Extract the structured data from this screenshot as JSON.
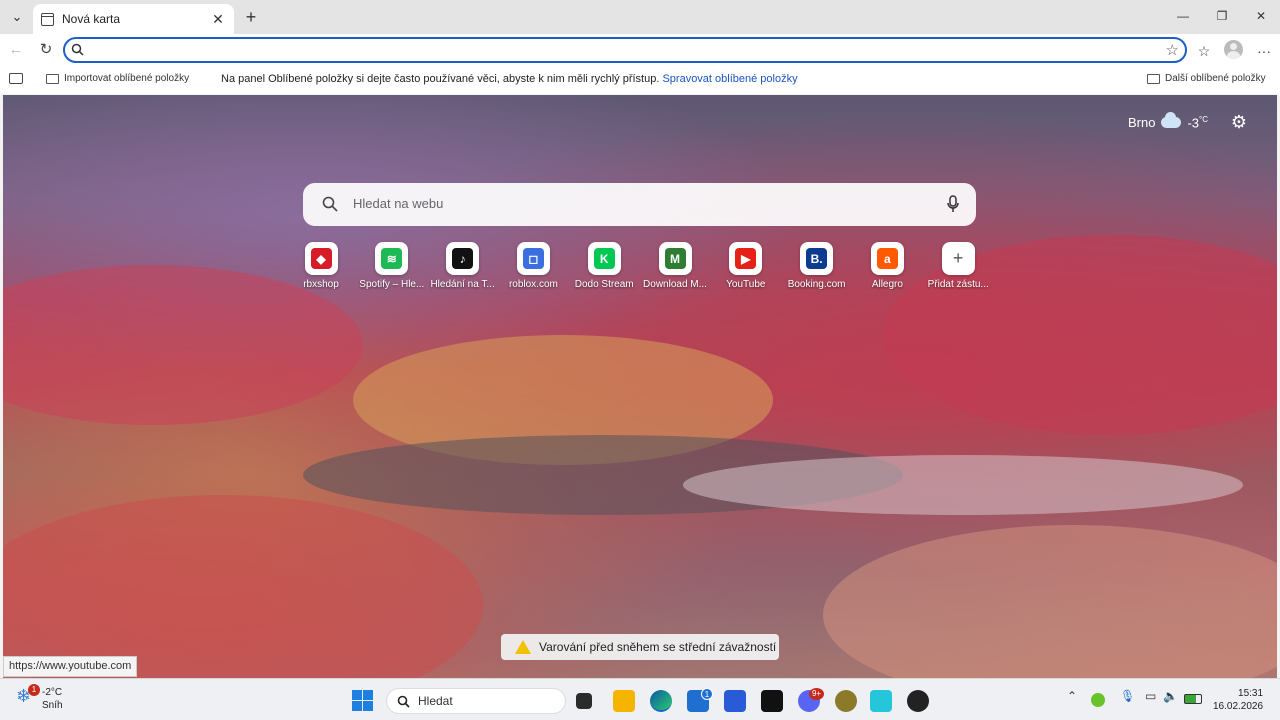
{
  "browser": {
    "tab_title": "Nová karta",
    "address_value": "",
    "address_placeholder": ""
  },
  "favorites_bar": {
    "import_label": "Importovat oblíbené položky",
    "message": "Na panel Oblíbené položky si dejte často používané věci, abyste k nim měli rychlý přístup.",
    "manage_link": "Spravovat oblíbené položky",
    "other_favorites": "Další oblíbené položky"
  },
  "newtab": {
    "weather_city": "Brno",
    "weather_temp": "-3",
    "weather_unit": "°C",
    "search_placeholder": "Hledat na webu",
    "tiles": [
      {
        "label": "rbxshop",
        "color": "#d81b29",
        "glyph": "◆"
      },
      {
        "label": "Spotify – Hle...",
        "color": "#1db954",
        "glyph": "≋"
      },
      {
        "label": "Hledání na T...",
        "color": "#111111",
        "glyph": "♪"
      },
      {
        "label": "roblox.com",
        "color": "#3b6fe0",
        "glyph": "◻"
      },
      {
        "label": "Dodo Stream",
        "color": "#00c853",
        "glyph": "K"
      },
      {
        "label": "Download M...",
        "color": "#2e7d32",
        "glyph": "M"
      },
      {
        "label": "YouTube",
        "color": "#e62117",
        "glyph": "▶"
      },
      {
        "label": "Booking.com",
        "color": "#0c3b8f",
        "glyph": "B."
      },
      {
        "label": "Allegro",
        "color": "#ff5a00",
        "glyph": "a"
      },
      {
        "label": "Přidat zástu...",
        "color": "#ffffff",
        "glyph": "+"
      }
    ],
    "alert_text": "Varování před sněhem se střední závažností"
  },
  "status_url": "https://www.youtube.com",
  "taskbar": {
    "weather_temp": "-2°C",
    "weather_desc": "Sníh",
    "weather_badge": "1",
    "search_label": "Hledat",
    "store_badge": "1",
    "discord_badge": "9+",
    "time": "15:31",
    "date": "16.02.2026"
  }
}
